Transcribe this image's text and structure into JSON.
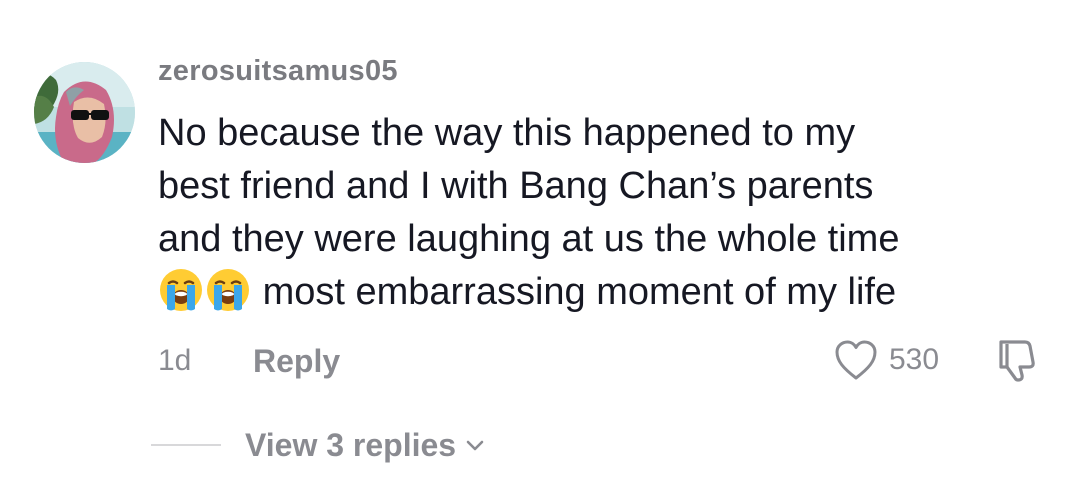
{
  "comment": {
    "username": "zerosuitsamus05",
    "text_lines": [
      "No because the way this happened to my",
      "best friend and I with Bang Chan’s parents",
      "and they were laughing at us the whole time",
      "most embarrassing moment of my life"
    ],
    "emojis": [
      "loudly-crying-face",
      "loudly-crying-face"
    ],
    "time": "1d",
    "reply_label": "Reply",
    "like_count": "530",
    "view_replies_label": "View 3 replies"
  },
  "icons": {
    "like": "heart-outline-icon",
    "dislike": "thumbs-down-outline-icon",
    "expand": "chevron-down-icon"
  },
  "colors": {
    "username": "#7a7b80",
    "text": "#161823",
    "muted": "#8a8b91"
  }
}
